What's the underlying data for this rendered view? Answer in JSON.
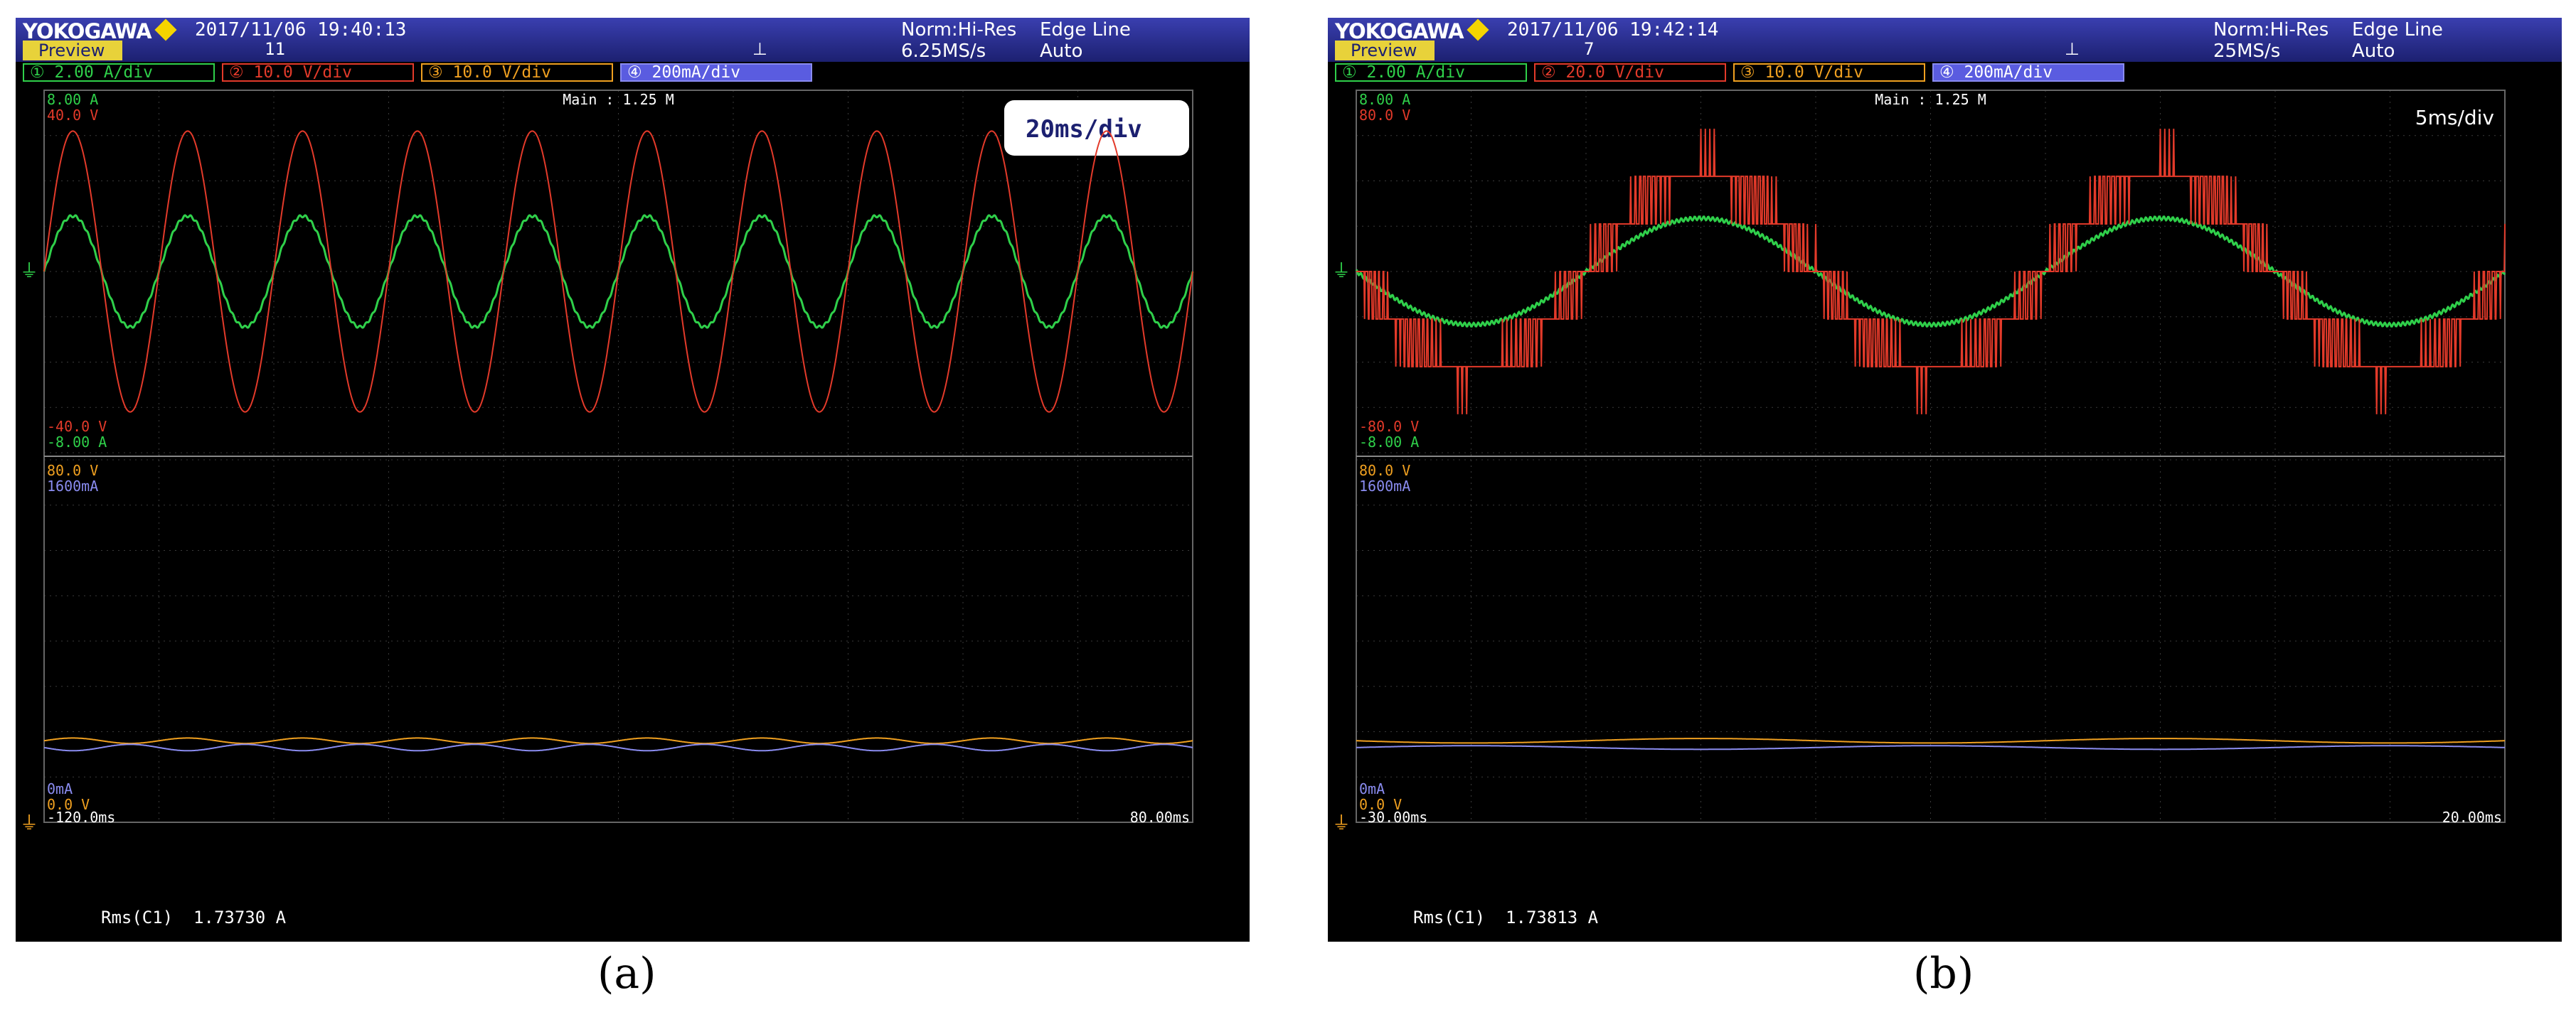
{
  "scopes": [
    {
      "panel_label": "(a)",
      "brand": "YOKOGAWA",
      "datetime": "2017/11/06  19:40:13",
      "mode": "Norm:Hi-Res",
      "sample_rate": "6.25MS/s",
      "trigger": "Edge Line",
      "trigger_mode": "Auto",
      "preview": "Preview",
      "acq_count": "11",
      "channels": [
        "① 2.00 A/div",
        "② 10.0 V/div",
        "③ 10.0 V/div",
        "④ 200mA/div"
      ],
      "main_label": "Main : 1.25 M",
      "timebase": "20ms/div",
      "upper_top": [
        "8.00 A",
        "40.0 V"
      ],
      "upper_bottom": [
        "-40.0 V",
        "-8.00 A"
      ],
      "lower_top": [
        "80.0 V",
        "1600mA"
      ],
      "lower_bottom": [
        "0mA",
        "0.0 V"
      ],
      "t_start": "-120.0ms",
      "t_end": "80.00ms",
      "measurement": "Rms(C1)  1.73730 A"
    },
    {
      "panel_label": "(b)",
      "brand": "YOKOGAWA",
      "datetime": "2017/11/06  19:42:14",
      "mode": "Norm:Hi-Res",
      "sample_rate": "25MS/s",
      "trigger": "Edge Line",
      "trigger_mode": "Auto",
      "preview": "Preview",
      "acq_count": "7",
      "channels": [
        "① 2.00 A/div",
        "② 20.0 V/div",
        "③ 10.0 V/div",
        "④ 200mA/div"
      ],
      "main_label": "Main : 1.25 M",
      "timebase": "5ms/div",
      "upper_top": [
        "8.00 A",
        "80.0 V"
      ],
      "upper_bottom": [
        "-80.0 V",
        "-8.00 A"
      ],
      "lower_top": [
        "80.0 V",
        "1600mA"
      ],
      "lower_bottom": [
        "0mA",
        "0.0 V"
      ],
      "t_start": "-30.00ms",
      "t_end": "20.00ms",
      "measurement": "Rms(C1)  1.73813 A"
    }
  ],
  "colors": {
    "ch1": "#2fd04a",
    "ch2": "#e33a2a",
    "ch3": "#f0a020",
    "ch4": "#8a8cf0",
    "grid": "#3a3a3a"
  },
  "chart_data": [
    {
      "type": "line",
      "title": "",
      "x_range_ms": [
        -120,
        80
      ],
      "series": [
        {
          "channel": "ch1",
          "waveform": "sine",
          "unit": "A",
          "amplitude": 2.45,
          "offset": 0,
          "frequency_hz": 50,
          "phase_deg": 0
        },
        {
          "channel": "ch2",
          "waveform": "sine",
          "unit": "V",
          "amplitude": 31,
          "offset": 0,
          "frequency_hz": 50,
          "phase_deg": 0
        },
        {
          "channel": "ch3",
          "waveform": "sine",
          "unit": "V",
          "amplitude": 0.6,
          "offset": 18,
          "frequency_hz": 50,
          "phase_deg": 0
        },
        {
          "channel": "ch4",
          "waveform": "sine",
          "unit": "mA",
          "amplitude": 14,
          "offset": 330,
          "frequency_hz": 50,
          "phase_deg": 180
        }
      ]
    },
    {
      "type": "line",
      "title": "",
      "x_range_ms": [
        -30,
        20
      ],
      "series": [
        {
          "channel": "ch1",
          "waveform": "sine",
          "unit": "A",
          "amplitude": 2.35,
          "offset": 0,
          "frequency_hz": 50,
          "phase_deg": 0
        },
        {
          "channel": "ch2",
          "waveform": "pwm_multilevel",
          "unit": "V",
          "amplitude": 42,
          "offset": 0,
          "frequency_hz": 50,
          "phase_deg": 0
        },
        {
          "channel": "ch3",
          "waveform": "sine",
          "unit": "V",
          "amplitude": 0.5,
          "offset": 18,
          "frequency_hz": 50,
          "phase_deg": 0
        },
        {
          "channel": "ch4",
          "waveform": "sine",
          "unit": "mA",
          "amplitude": 8,
          "offset": 330,
          "frequency_hz": 50,
          "phase_deg": 180
        }
      ]
    }
  ]
}
